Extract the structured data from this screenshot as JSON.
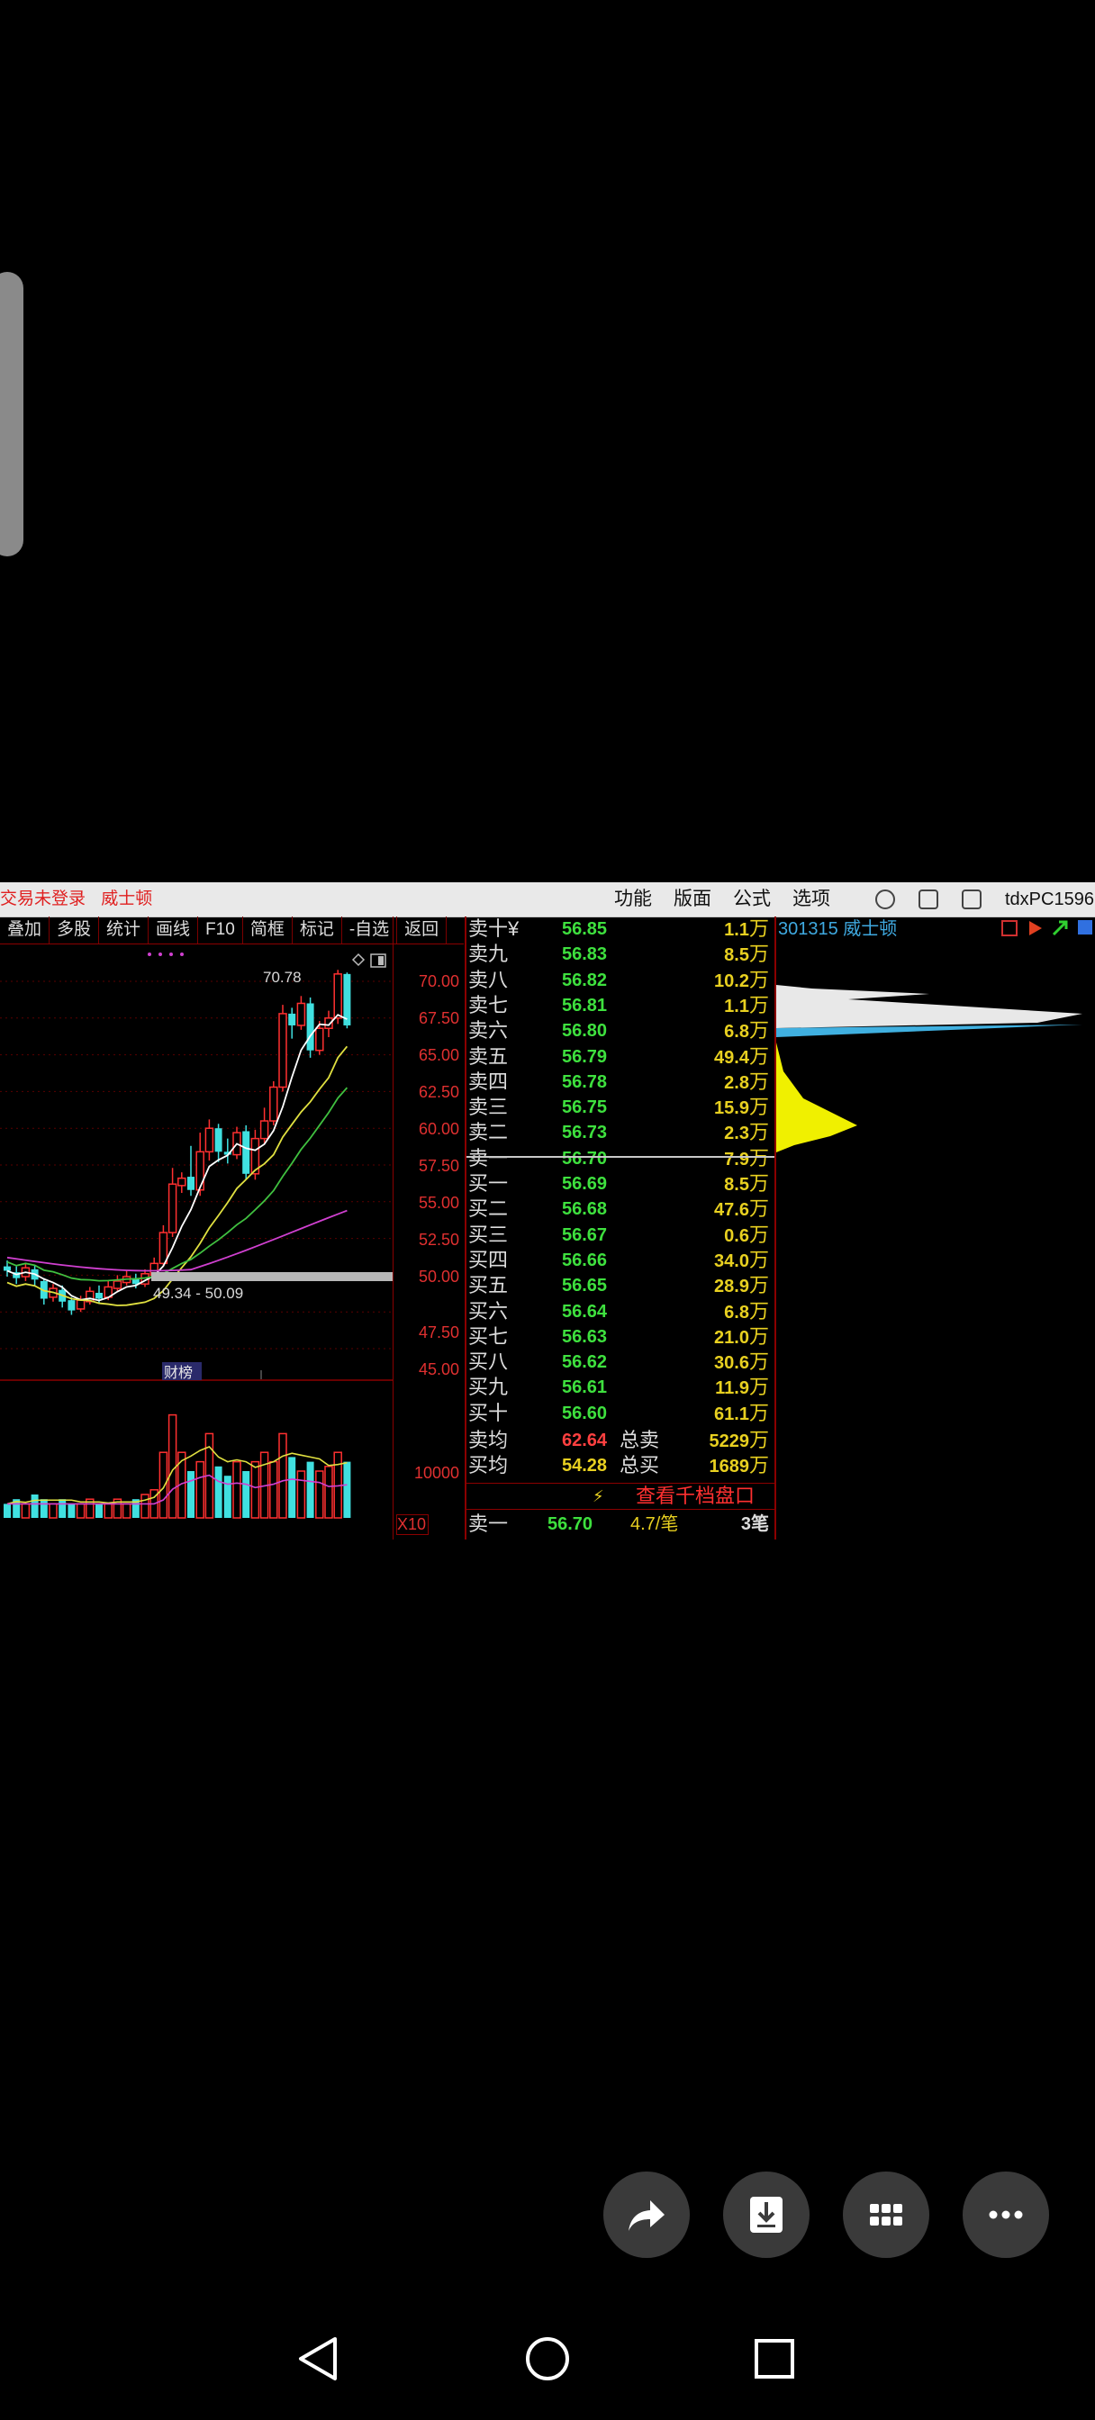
{
  "app": {
    "status_left": "交易未登录",
    "stock_name_top": "威士顿",
    "menu": [
      "功能",
      "版面",
      "公式",
      "选项"
    ],
    "pc_name": "tdxPC1596"
  },
  "toolbar": [
    "叠加",
    "多股",
    "统计",
    "画线",
    "F10",
    "简框",
    "标记",
    "-自选",
    "返回"
  ],
  "chart": {
    "price_labels": [
      "70.00",
      "67.50",
      "65.00",
      "62.50",
      "60.00",
      "57.50",
      "55.00",
      "52.50",
      "50.00",
      "47.50",
      "45.00"
    ],
    "high_label": "70.78",
    "range_label": "49.34 - 50.09",
    "badge_label": "财榜",
    "volume_label": "10000",
    "volume_mult": "X10",
    "colors": {
      "up": "#ff3030",
      "down": "#40e0e0",
      "ma5": "#ffffff",
      "ma10": "#e0e040",
      "ma20": "#40c040",
      "ma60": "#d040d0"
    }
  },
  "orderbook": {
    "asks": [
      {
        "label": "卖十",
        "suffix": "¥",
        "price": "56.85",
        "vol": "1.1",
        "unit": "万"
      },
      {
        "label": "卖九",
        "suffix": "",
        "price": "56.83",
        "vol": "8.5",
        "unit": "万"
      },
      {
        "label": "卖八",
        "suffix": "",
        "price": "56.82",
        "vol": "10.2",
        "unit": "万"
      },
      {
        "label": "卖七",
        "suffix": "",
        "price": "56.81",
        "vol": "1.1",
        "unit": "万"
      },
      {
        "label": "卖六",
        "suffix": "",
        "price": "56.80",
        "vol": "6.8",
        "unit": "万"
      },
      {
        "label": "卖五",
        "suffix": "",
        "price": "56.79",
        "vol": "49.4",
        "unit": "万"
      },
      {
        "label": "卖四",
        "suffix": "",
        "price": "56.78",
        "vol": "2.8",
        "unit": "万"
      },
      {
        "label": "卖三",
        "suffix": "",
        "price": "56.75",
        "vol": "15.9",
        "unit": "万"
      },
      {
        "label": "卖二",
        "suffix": "",
        "price": "56.73",
        "vol": "2.3",
        "unit": "万"
      },
      {
        "label": "卖一",
        "suffix": "",
        "price": "56.70",
        "vol": "7.9",
        "unit": "万"
      }
    ],
    "bids": [
      {
        "label": "买一",
        "price": "56.69",
        "vol": "8.5",
        "unit": "万"
      },
      {
        "label": "买二",
        "price": "56.68",
        "vol": "47.6",
        "unit": "万"
      },
      {
        "label": "买三",
        "price": "56.67",
        "vol": "0.6",
        "unit": "万"
      },
      {
        "label": "买四",
        "price": "56.66",
        "vol": "34.0",
        "unit": "万"
      },
      {
        "label": "买五",
        "price": "56.65",
        "vol": "28.9",
        "unit": "万"
      },
      {
        "label": "买六",
        "price": "56.64",
        "vol": "6.8",
        "unit": "万"
      },
      {
        "label": "买七",
        "price": "56.63",
        "vol": "21.0",
        "unit": "万"
      },
      {
        "label": "买八",
        "price": "56.62",
        "vol": "30.6",
        "unit": "万"
      },
      {
        "label": "买九",
        "price": "56.61",
        "vol": "11.9",
        "unit": "万"
      },
      {
        "label": "买十",
        "price": "56.60",
        "vol": "61.1",
        "unit": "万"
      }
    ],
    "sell_avg_label": "卖均",
    "sell_avg": "62.64",
    "total_sell_label": "总卖",
    "total_sell": "5229",
    "buy_avg_label": "买均",
    "buy_avg": "54.28",
    "total_buy_label": "总买",
    "total_buy": "1689",
    "unit": "万",
    "thousand_link": "查看千档盘口",
    "tick": {
      "label": "卖一",
      "price": "56.70",
      "vol": "4.7/笔",
      "count": "3笔"
    }
  },
  "stock_header": "301315 威士顿"
}
